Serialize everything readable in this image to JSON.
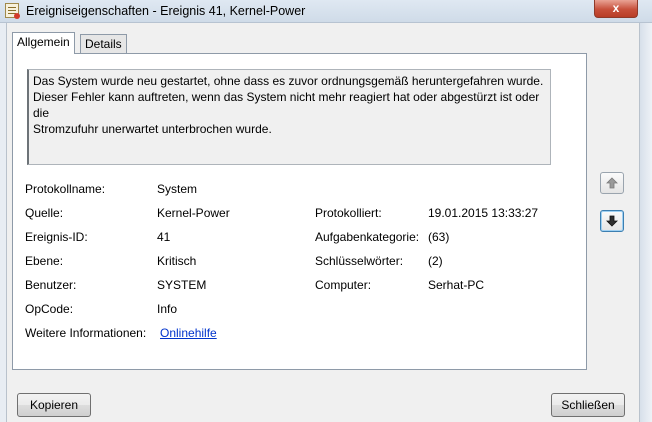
{
  "window": {
    "title": "Ereigniseigenschaften - Ereignis 41, Kernel-Power",
    "close_glyph": "x"
  },
  "tabs": [
    {
      "label": "Allgemein",
      "active": true
    },
    {
      "label": "Details",
      "active": false
    }
  ],
  "description": {
    "lines": [
      "Das System wurde neu gestartet, ohne dass es zuvor ordnungsgemäß heruntergefahren wurde.",
      "Dieser Fehler kann auftreten, wenn das System nicht mehr reagiert hat oder abgestürzt ist oder die",
      "Stromzufuhr unerwartet unterbrochen wurde."
    ]
  },
  "fields": {
    "protokollname": {
      "label": "Protokollname:",
      "value": "System"
    },
    "quelle": {
      "label": "Quelle:",
      "value": "Kernel-Power"
    },
    "protokolliert": {
      "label": "Protokolliert:",
      "value": "19.01.2015 13:33:27"
    },
    "ereignis_id": {
      "label": "Ereignis-ID:",
      "value": "41"
    },
    "aufgabenkategorie": {
      "label": "Aufgabenkategorie:",
      "value": "(63)"
    },
    "ebene": {
      "label": "Ebene:",
      "value": "Kritisch"
    },
    "schluesselwoerter": {
      "label": "Schlüsselwörter:",
      "value": "(2)"
    },
    "benutzer": {
      "label": "Benutzer:",
      "value": "SYSTEM"
    },
    "computer": {
      "label": "Computer:",
      "value": "Serhat-PC"
    },
    "opcode": {
      "label": "OpCode:",
      "value": "Info"
    },
    "weitere": {
      "label": "Weitere Informationen:",
      "link": "Onlinehilfe"
    }
  },
  "nav": {
    "up_icon": "arrow-up-icon",
    "down_icon": "arrow-down-icon"
  },
  "buttons": {
    "copy": "Kopieren",
    "close": "Schließen"
  },
  "colors": {
    "link": "#0033cc",
    "close_button": "#c7503b",
    "focus_border": "#3c7fb1"
  }
}
